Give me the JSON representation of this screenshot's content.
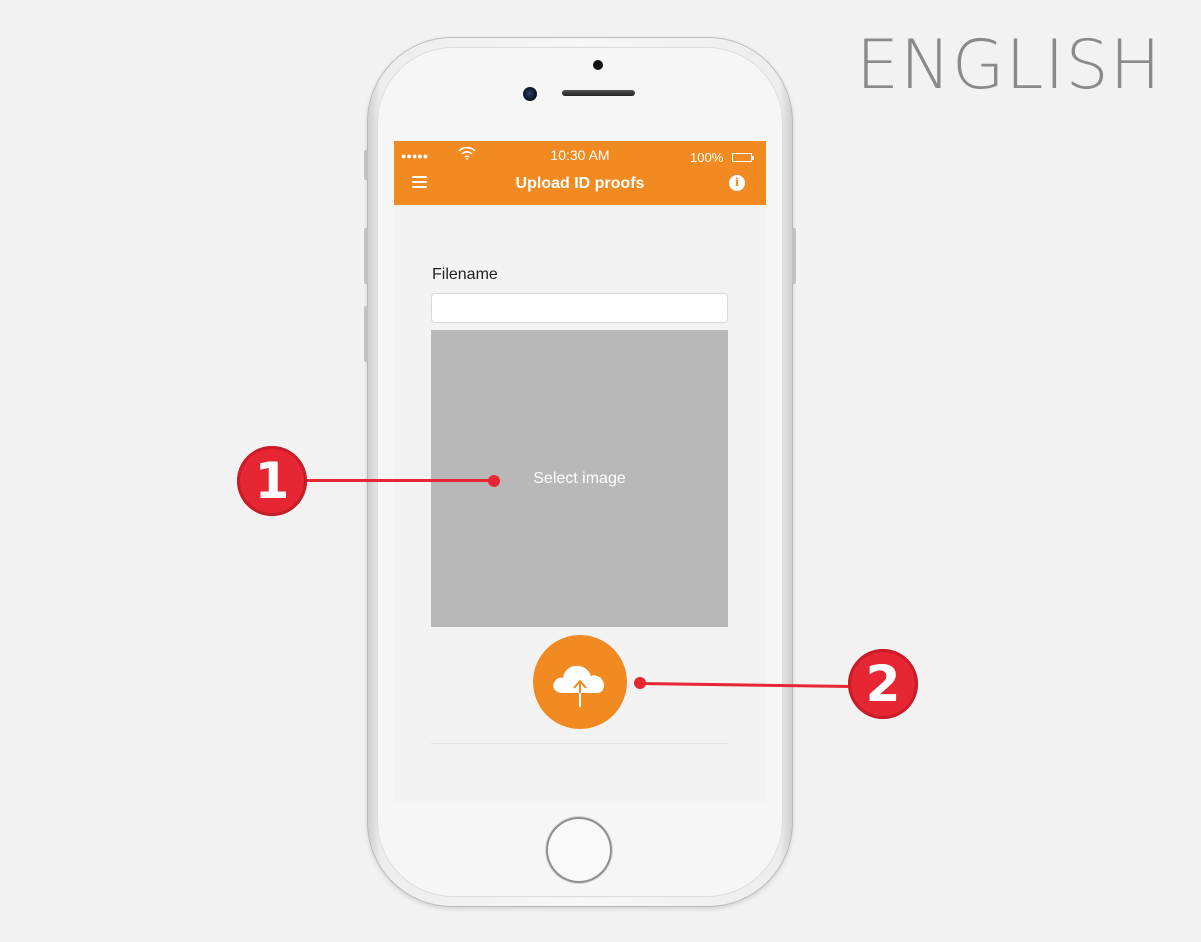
{
  "language_label": "ENGLISH",
  "status_bar": {
    "signal": "●●●●●",
    "time": "10:30 AM",
    "battery": "100%"
  },
  "app_bar": {
    "title": "Upload ID proofs",
    "menu_icon": "hamburger-menu-icon",
    "info_icon": "info-icon",
    "info_glyph": "i"
  },
  "form": {
    "filename_label": "Filename",
    "filename_value": "",
    "select_image_label": "Select image",
    "upload_icon": "cloud-upload-icon"
  },
  "callouts": [
    {
      "number": "1"
    },
    {
      "number": "2"
    }
  ],
  "colors": {
    "accent": "#f18a21",
    "callout": "#e62632",
    "image_placeholder": "#b8b8b8",
    "background": "#f2f2f2"
  }
}
